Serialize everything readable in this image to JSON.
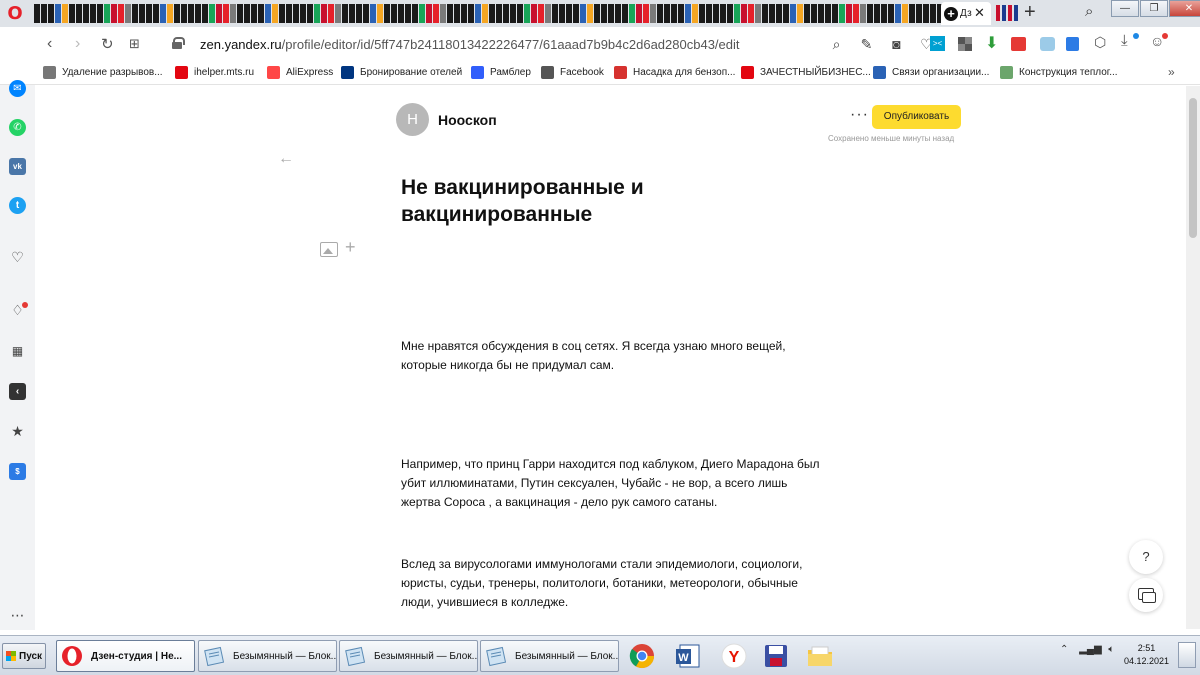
{
  "browser": {
    "active_tab_label": "Дз",
    "url_host": "zen.yandex.ru",
    "url_path": "/profile/editor/id/5ff747b24118013422226477/61aaad7b9b4c2d6ad280cb43/edit"
  },
  "bookmarks": [
    {
      "label": "Удаление разрывов...",
      "icon": "page-icon",
      "color": "#777777"
    },
    {
      "label": "ihelper.mts.ru",
      "icon": "mts-icon",
      "color": "#e30611"
    },
    {
      "label": "AliExpress",
      "icon": "aliexpress-icon",
      "color": "#ff4747"
    },
    {
      "label": "Бронирование отелей",
      "icon": "booking-icon",
      "color": "#003580"
    },
    {
      "label": "Рамблер",
      "icon": "rambler-icon",
      "color": "#315efb"
    },
    {
      "label": "Facebook",
      "icon": "page-icon",
      "color": "#555555"
    },
    {
      "label": "Насадка для бензоп...",
      "icon": "pin-icon",
      "color": "#d6322f"
    },
    {
      "label": "ЗАЧЕСТНЫЙБИЗНЕС...",
      "icon": "za-icon",
      "color": "#e30611"
    },
    {
      "label": "Связи организации...",
      "icon": "list-org-icon",
      "color": "#2a62b5"
    },
    {
      "label": "Конструкция теплог...",
      "icon": "link-icon",
      "color": "#6ca66c"
    }
  ],
  "editor": {
    "channel_avatar_letter": "Н",
    "channel_name": "Нооскоп",
    "more_label": "···",
    "publish_label": "Опубликовать",
    "saved_note": "Сохранено меньше минуты назад",
    "title": "Не вакцинированные и вакцинированные",
    "paragraphs": [
      "Мне нравятся обсуждения в соц сетях. Я всегда узнаю много вещей, которые никогда бы не придумал сам.",
      "Например, что принц Гарри находится под каблуком, Диего Марадона был убит иллюминатами, Путин сексуален, Чубайс - не вор, а всего лишь жертва  Сороса , а вакцинация - дело рук самого сатаны.",
      " Вслед за вирусологами иммунологами стали эпидемиологи, социологи, юристы, судьи, тренеры, политологи, ботаники, метеорологи, обычные люди, учившиеся в колледже."
    ],
    "help_label": "?"
  },
  "taskbar": {
    "start_label": "Пуск",
    "items": [
      {
        "label": "Дзен-студия | Не...",
        "icon": "opera-icon",
        "active": true
      },
      {
        "label": "Безымянный — Блок...",
        "icon": "notepad-icon",
        "active": false
      },
      {
        "label": "Безымянный — Блок...",
        "icon": "notepad-icon",
        "active": false
      },
      {
        "label": "Безымянный — Блок...",
        "icon": "notepad-icon",
        "active": false
      }
    ],
    "time": "2:51",
    "date": "04.12.2021"
  },
  "colors": {
    "publish_button": "#fddb2f",
    "opera_red": "#e6212a"
  }
}
